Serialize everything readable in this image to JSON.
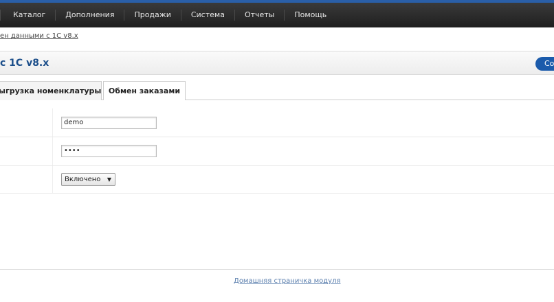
{
  "nav": {
    "items": [
      "Каталог",
      "Дополнения",
      "Продажи",
      "Система",
      "Отчеты",
      "Помощь"
    ]
  },
  "breadcrumb": {
    "text": "ен данными с 1С v8.x"
  },
  "heading": {
    "title": "с 1С v8.x",
    "button_label": "Со"
  },
  "tabs": [
    {
      "label": "ыгрузка номенклатуры"
    },
    {
      "label": "Обмен заказами"
    }
  ],
  "form": {
    "username": {
      "value": "demo"
    },
    "password": {
      "value": "••••"
    },
    "status": {
      "value": "Включено",
      "arrow": "▼"
    }
  },
  "footer": {
    "link": "Домашняя страничка модуля"
  },
  "colors": {
    "accent": "#1b5bab",
    "title": "#1b4e8a"
  }
}
